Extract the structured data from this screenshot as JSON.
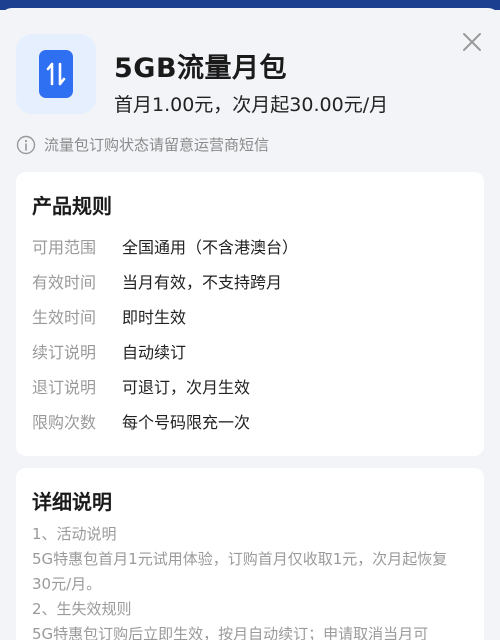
{
  "product": {
    "title": "5GB流量月包",
    "price": "首月1.00元，次月起30.00元/月",
    "icon": "data-transfer-icon"
  },
  "notice": {
    "text": "流量包订购状态请留意运营商短信",
    "icon": "info-icon"
  },
  "rules": {
    "title": "产品规则",
    "rows": [
      {
        "key": "可用范围",
        "value": "全国通用（不含港澳台）"
      },
      {
        "key": "有效时间",
        "value": "当月有效，不支持跨月"
      },
      {
        "key": "生效时间",
        "value": "即时生效"
      },
      {
        "key": "续订说明",
        "value": "自动续订"
      },
      {
        "key": "退订说明",
        "value": "可退订，次月生效"
      },
      {
        "key": "限购次数",
        "value": "每个号码限充一次"
      }
    ]
  },
  "details": {
    "title": "详细说明",
    "lines": [
      "1、活动说明",
      "5G特惠包首月1元试用体验，订购首月仅收取1元，次月起恢复",
      "30元/月。",
      "2、生失效规则",
      "5G特惠包订购后立即生效，按月自动续订；申请取消当月可"
    ]
  },
  "colors": {
    "accent": "#2f6ff2",
    "icon_bg": "#e5effd",
    "background": "#f2f4f8"
  }
}
